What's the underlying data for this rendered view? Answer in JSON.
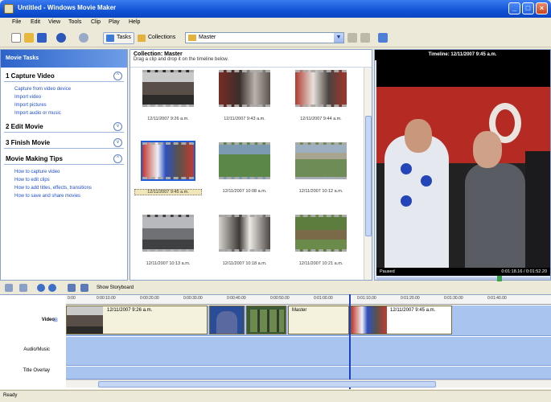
{
  "window": {
    "title": "Untitled - Windows Movie Maker"
  },
  "menu": [
    "File",
    "Edit",
    "View",
    "Tools",
    "Clip",
    "Play",
    "Help"
  ],
  "toolbar": {
    "tasks_label": "Tasks",
    "collections_label": "Collections",
    "collection_value": "Master"
  },
  "tasks": {
    "header": "Movie Tasks",
    "sections": [
      {
        "label": "1  Capture Video",
        "links": [
          "Capture from video device",
          "Import video",
          "Import pictures",
          "Import audio or music"
        ]
      },
      {
        "label": "2  Edit Movie",
        "links": []
      },
      {
        "label": "3  Finish Movie",
        "links": []
      },
      {
        "label": "Movie Making Tips",
        "links": [
          "How to capture video",
          "How to edit clips",
          "How to add titles, effects, transitions",
          "How to save and share movies"
        ]
      }
    ]
  },
  "collection": {
    "title": "Collection: Master",
    "subtitle": "Drag a clip and drop it on the timeline below.",
    "clips": [
      "12/11/2007 9:26 a.m.",
      "12/11/2007 9:43 a.m.",
      "12/11/2007 9:44 a.m.",
      "12/11/2007 9:45 a.m.",
      "12/11/2007 10:08 a.m.",
      "12/11/2007 10:12 a.m.",
      "12/11/2007 10:13 a.m.",
      "12/11/2007 10:18 a.m.",
      "12/11/2007 10:21 a.m."
    ]
  },
  "preview": {
    "title": "Timeline: 12/11/2007 9:45 a.m.",
    "status": "Paused",
    "time": "0:01:18.16 / 0:01:52.20"
  },
  "storyboard": {
    "show_label": "Show Storyboard"
  },
  "timeline": {
    "ruler": [
      "0:00",
      "0:00:10.00",
      "0:00:20.00",
      "0:00:30.00",
      "0:00:40.00",
      "0:00:50.00",
      "0:01:00.00",
      "0:01:10.00",
      "0:01:20.00",
      "0:01:30.00",
      "0:01:40.00"
    ],
    "tracks": {
      "video": "Video",
      "audio": "Audio/Music",
      "title": "Title Overlay"
    },
    "segments": [
      "12/11/2007 9:26 a.m.",
      "Master",
      "12/11/2007 9:45 a.m."
    ]
  },
  "status": "Ready"
}
